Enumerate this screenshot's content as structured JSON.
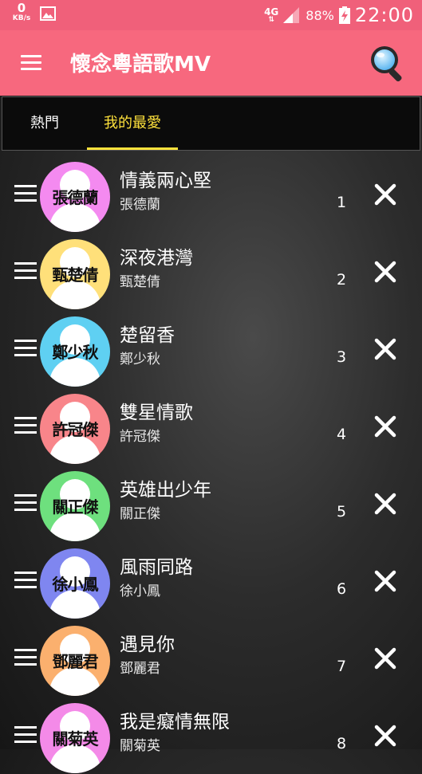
{
  "status_bar": {
    "speed_value": "0",
    "speed_unit": "KB/s",
    "network": "4G",
    "network_arrows": "⇅",
    "battery": "88%",
    "time": "22:00"
  },
  "toolbar": {
    "title": "懷念粵語歌MV",
    "menu_icon": "hamburger-menu-icon",
    "search_icon": "magnifier-icon"
  },
  "tabs": [
    {
      "label": "熱門",
      "selected": false
    },
    {
      "label": "我的最愛",
      "selected": true
    }
  ],
  "colors": {
    "status_bar": "#f0607a",
    "toolbar": "#f7687e",
    "tab_selected": "#ffe23c"
  },
  "songs": [
    {
      "title": "情義兩心堅",
      "artist": "張德蘭",
      "avatar_label": "張德蘭",
      "index": "1",
      "avatar_color": "#f48af0"
    },
    {
      "title": "深夜港灣",
      "artist": "甄楚倩",
      "avatar_label": "甄楚倩",
      "index": "2",
      "avatar_color": "#ffe07a"
    },
    {
      "title": "楚留香",
      "artist": "鄭少秋",
      "avatar_label": "鄭少秋",
      "index": "3",
      "avatar_color": "#5fd0f2"
    },
    {
      "title": "雙星情歌",
      "artist": "許冠傑",
      "avatar_label": "許冠傑",
      "index": "4",
      "avatar_color": "#f8858a"
    },
    {
      "title": "英雄出少年",
      "artist": "關正傑",
      "avatar_label": "關正傑",
      "index": "5",
      "avatar_color": "#6ee07e"
    },
    {
      "title": "風雨同路",
      "artist": "徐小鳳",
      "avatar_label": "徐小鳳",
      "index": "6",
      "avatar_color": "#7f86f0"
    },
    {
      "title": "遇見你",
      "artist": "鄧麗君",
      "avatar_label": "鄧麗君",
      "index": "7",
      "avatar_color": "#fbb06e"
    },
    {
      "title": "我是癡情無限",
      "artist": "關菊英",
      "avatar_label": "關菊英",
      "index": "8",
      "avatar_color": "#f48ae8"
    }
  ]
}
